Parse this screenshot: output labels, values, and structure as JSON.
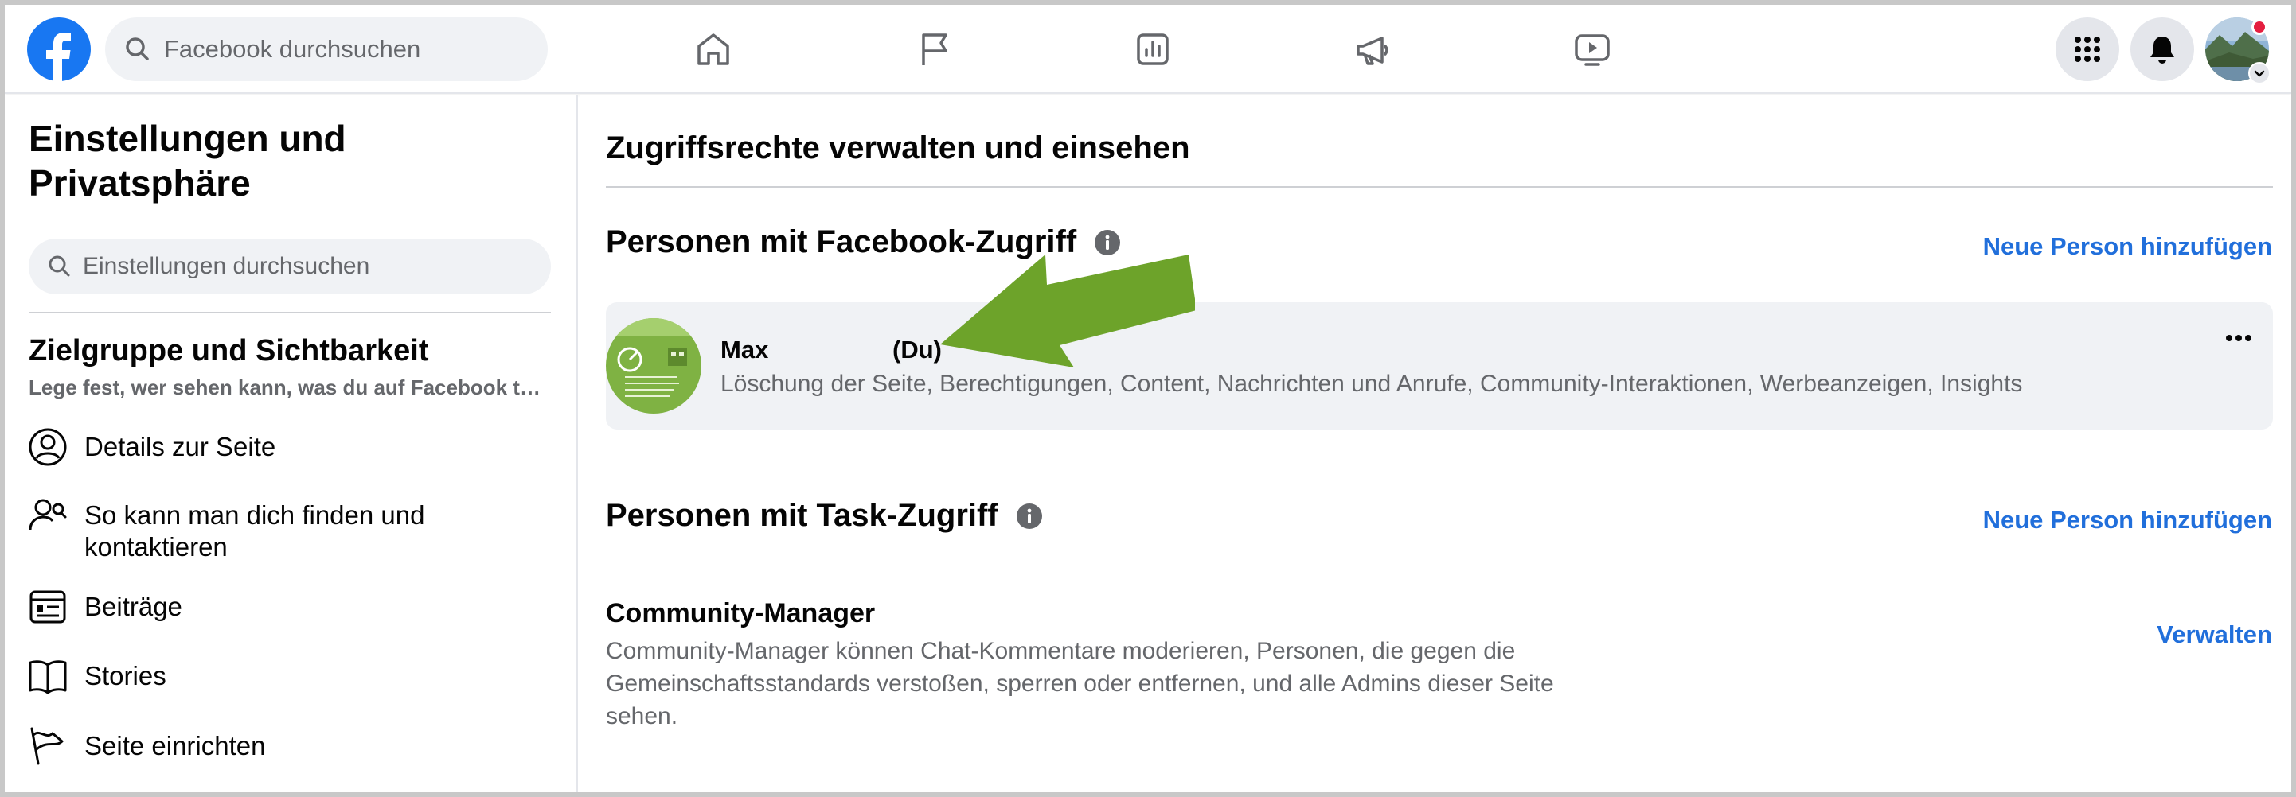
{
  "topbar": {
    "search_placeholder": "Facebook durchsuchen",
    "nav_icons": [
      "home-icon",
      "flag-icon",
      "insights-icon",
      "megaphone-icon",
      "video-icon"
    ],
    "brand_color": "#1877f2",
    "notification_color": "#e41e3f"
  },
  "sidebar": {
    "title": "Einstellungen und Privatsphäre",
    "search_placeholder": "Einstellungen durchsuchen",
    "section_title": "Zielgruppe und Sichtbarkeit",
    "section_subtitle": "Lege fest, wer sehen kann, was du auf Facebook t…",
    "items": [
      {
        "label": "Details zur Seite",
        "icon": "person-circle-icon"
      },
      {
        "label": "So kann man dich finden und kontaktieren",
        "icon": "person-search-icon"
      },
      {
        "label": "Beiträge",
        "icon": "posts-icon"
      },
      {
        "label": "Stories",
        "icon": "book-icon"
      },
      {
        "label": "Seite einrichten",
        "icon": "flag-icon"
      }
    ]
  },
  "main": {
    "title": "Zugriffsrechte verwalten und einsehen",
    "facebook_access": {
      "heading": "Personen mit Facebook-Zugriff",
      "add_link": "Neue Person hinzufügen",
      "person": {
        "name": "Max",
        "you_label": "(Du)",
        "permissions": "Löschung der Seite, Berechtigungen, Content, Nachrichten und Anrufe, Community-Interaktionen, Werbeanzeigen, Insights"
      },
      "arrow_color": "#6da32a"
    },
    "task_access": {
      "heading": "Personen mit Task-Zugriff",
      "add_link": "Neue Person hinzufügen",
      "role": {
        "title": "Community-Manager",
        "description": "Community-Manager können Chat-Kommentare moderieren, Personen, die gegen die Gemeinschaftsstandards verstoßen, sperren oder entfernen, und alle Admins dieser Seite sehen.",
        "action": "Verwalten"
      }
    },
    "link_color": "#216fdb"
  }
}
